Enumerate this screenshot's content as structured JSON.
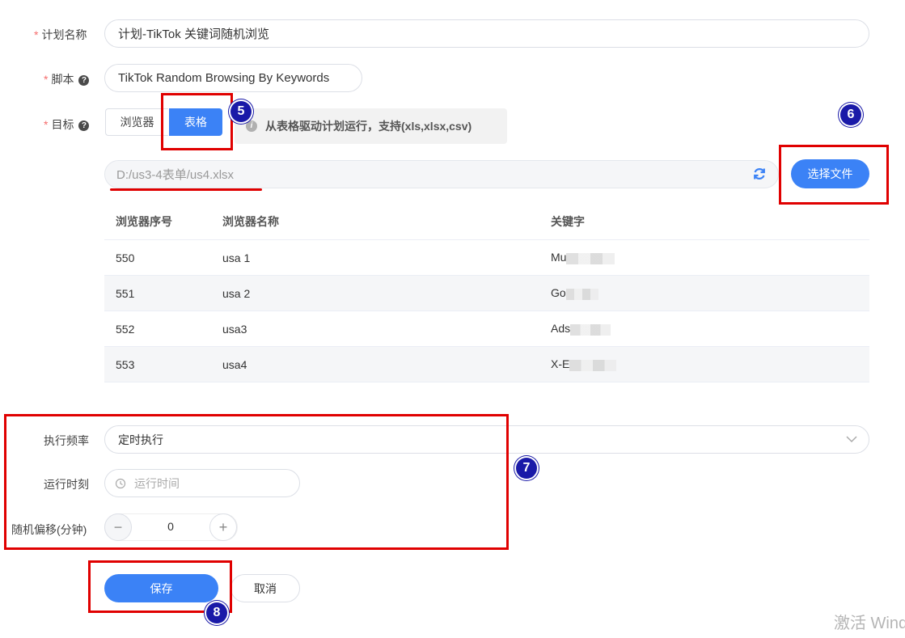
{
  "form": {
    "plan_name_label": "计划名称",
    "plan_name_value": "计划-TikTok 关键词随机浏览",
    "script_label": "脚本",
    "script_value": "TikTok Random Browsing By Keywords",
    "target_label": "目标",
    "target_options": [
      "浏览器",
      "表格"
    ],
    "target_selected": "表格",
    "target_hint": "从表格驱动计划运行，支持(xls,xlsx,csv)",
    "file_path": "D:/us3-4表单/us4.xlsx",
    "choose_file_label": "选择文件",
    "frequency_label": "执行频率",
    "frequency_value": "定时执行",
    "run_time_label": "运行时刻",
    "run_time_placeholder": "运行时间",
    "offset_label": "随机偏移(分钟)",
    "offset_value": "0",
    "save_label": "保存",
    "cancel_label": "取消"
  },
  "table": {
    "headers": [
      "浏览器序号",
      "浏览器名称",
      "关键字"
    ],
    "rows": [
      {
        "id": "550",
        "name": "usa 1",
        "keyword": "Mu"
      },
      {
        "id": "551",
        "name": "usa 2",
        "keyword": "Go"
      },
      {
        "id": "552",
        "name": "usa3",
        "keyword": "Ads"
      },
      {
        "id": "553",
        "name": "usa4",
        "keyword": "X-E"
      }
    ]
  },
  "annotations": {
    "step5": "5",
    "step6": "6",
    "step7": "7",
    "step8": "8"
  },
  "watermark": {
    "line1": "激活 Wind"
  },
  "colors": {
    "primary": "#3b82f6",
    "required": "#f56c6c",
    "annotation_red": "#e00000",
    "badge_blue": "#1a1aa8"
  }
}
